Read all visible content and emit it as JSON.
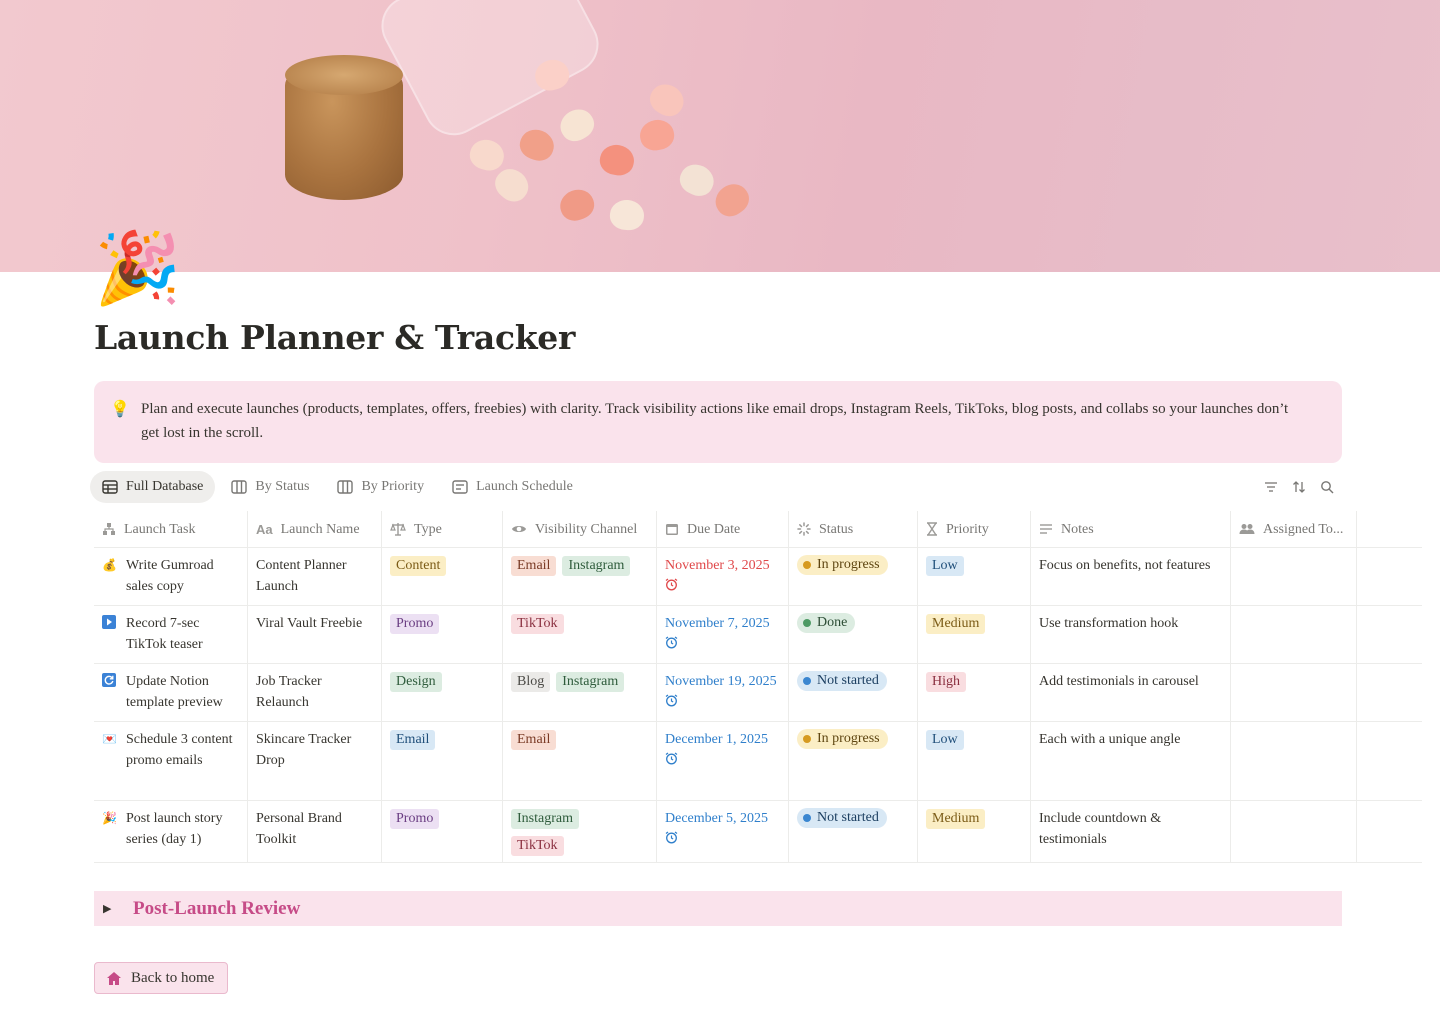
{
  "page": {
    "icon": "🎉",
    "title": "Launch Planner & Tracker",
    "callout_icon": "💡",
    "callout_text": "Plan and execute launches (products, templates, offers, freebies) with clarity. Track visibility actions like email drops, Instagram Reels, TikToks, blog posts, and collabs  so your launches don’t get lost in the scroll."
  },
  "tabs": [
    {
      "label": "Full Database",
      "icon": "table-icon",
      "active": true
    },
    {
      "label": "By Status",
      "icon": "board-icon"
    },
    {
      "label": "By Priority",
      "icon": "board-icon"
    },
    {
      "label": "Launch Schedule",
      "icon": "calendar-list-icon"
    }
  ],
  "columns": [
    {
      "label": "Launch Task",
      "icon": "hierarchy-icon"
    },
    {
      "label": "Launch Name",
      "icon": "text-aa-icon"
    },
    {
      "label": "Type",
      "icon": "scale-icon"
    },
    {
      "label": "Visibility Channel",
      "icon": "eye-icon"
    },
    {
      "label": "Due Date",
      "icon": "calendar-icon"
    },
    {
      "label": "Status",
      "icon": "status-spinner-icon"
    },
    {
      "label": "Priority",
      "icon": "hourglass-icon"
    },
    {
      "label": "Notes",
      "icon": "text-lines-icon"
    },
    {
      "label": "Assigned To...",
      "icon": "people-icon"
    }
  ],
  "rows": [
    {
      "task_icon": "💰",
      "task": "Write Gumroad sales copy",
      "name": "Content Planner Launch",
      "type": "Content",
      "channels": [
        "Email",
        "Instagram"
      ],
      "due": "November 3, 2025",
      "due_color": "red",
      "status": "In progress",
      "priority": "Low",
      "notes": "Focus on benefits, not features"
    },
    {
      "task_icon": "▶️",
      "task": "Record 7-sec TikTok teaser",
      "name": "Viral Vault Freebie",
      "type": "Promo",
      "channels": [
        "TikTok"
      ],
      "due": "November 7, 2025",
      "due_color": "blue",
      "status": "Done",
      "priority": "Medium",
      "notes": "Use transformation hook"
    },
    {
      "task_icon": "🔄",
      "task": "Update Notion template preview",
      "name": "Job Tracker Relaunch",
      "type": "Design",
      "channels": [
        "Blog",
        "Instagram"
      ],
      "due": "November 19, 2025",
      "due_color": "blue",
      "status": "Not started",
      "priority": "High",
      "notes": "Add testimonials in carousel"
    },
    {
      "task_icon": "💌",
      "task": "Schedule 3 content promo emails",
      "name": "Skincare Tracker Drop",
      "type": "Email",
      "channels": [
        "Email"
      ],
      "due": "December 1, 2025",
      "due_color": "blue",
      "status": "In progress",
      "priority": "Low",
      "notes": "Each with a unique angle"
    },
    {
      "task_icon": "🎉",
      "task": "Post launch story series (day 1)",
      "name": "Personal Brand Toolkit",
      "type": "Promo",
      "channels": [
        "Instagram",
        "TikTok"
      ],
      "due": "December 5, 2025",
      "due_color": "blue",
      "status": "Not started",
      "priority": "Medium",
      "notes": "Include countdown & testimonials"
    }
  ],
  "toggle": {
    "title": "Post-Launch Review"
  },
  "back_button": {
    "label": "Back to home",
    "icon": "house-icon"
  },
  "colors": {
    "callout_bg": "#fae3ec",
    "accent": "#c64b87",
    "due_red": "#e0484a",
    "due_blue": "#2f7fcb"
  }
}
